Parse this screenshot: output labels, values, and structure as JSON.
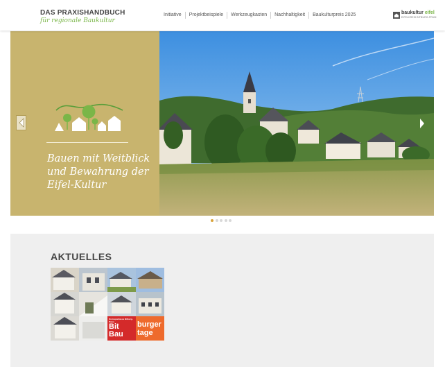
{
  "header": {
    "logo_line1": "DAS PRAXISHANDBUCH",
    "logo_line2": "für regionale Baukultur",
    "nav": [
      {
        "label": "Initiative"
      },
      {
        "label": "Projektbeispiele"
      },
      {
        "label": "Werkzeugkasten"
      },
      {
        "label": "Nachhaltigkeit"
      },
      {
        "label": "Baukulturpreis 2025"
      }
    ],
    "brand_part1": "baukultur",
    "brand_part2": "eifel",
    "brand_sub": "EIFELKREIS BITBURG-PRÜM"
  },
  "hero": {
    "text": "Bauen mit Weitblick und Bewahrung der Eifel-Kultur",
    "slides_total": 5,
    "active_slide": 1
  },
  "news": {
    "title": "AKTUELLES",
    "thumbnail_badge_line1": "Bit",
    "thumbnail_badge_line2": "Bau",
    "thumbnail_badge_line3": "burger",
    "thumbnail_badge_line4": "tage",
    "thumbnail_small_label": "Kreissparkasse Bitburg-Prüm"
  },
  "colors": {
    "accent_green": "#7ab648",
    "hero_panel": "#c8b46e",
    "active_dot": "#d9a43b",
    "news_bg": "#efefef",
    "badge_red": "#d42a2a",
    "badge_orange": "#ee6a2c"
  }
}
